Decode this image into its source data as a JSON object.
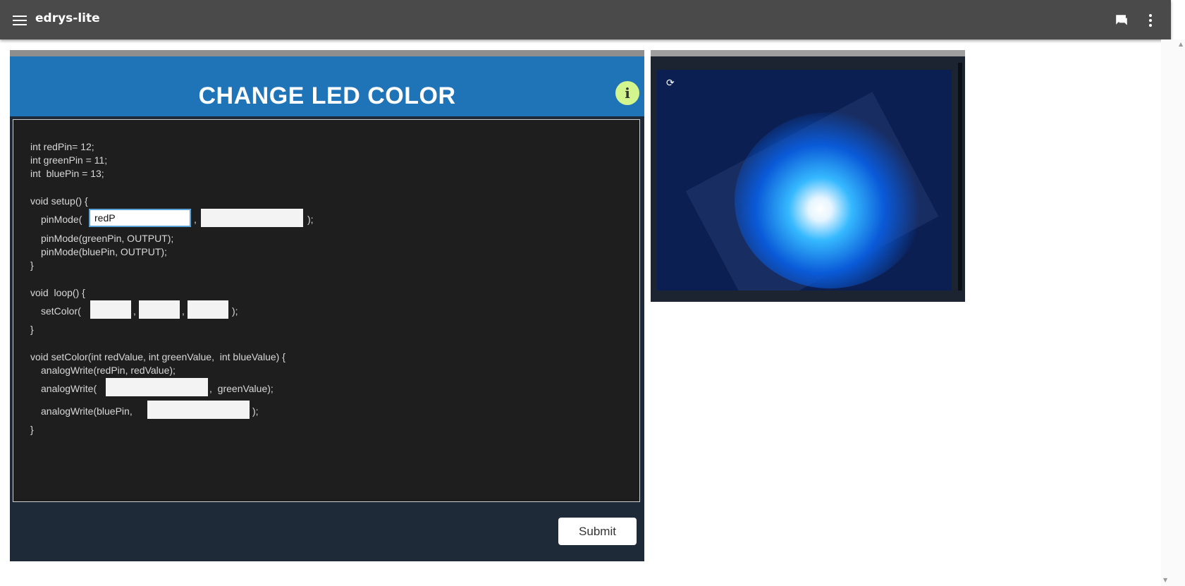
{
  "app": {
    "title": "edrys-lite"
  },
  "icons": {
    "menu": "menu-icon",
    "chat": "chat-icon",
    "more": "more-vertical-icon",
    "info": "info-icon",
    "refresh": "refresh-icon"
  },
  "panel": {
    "title": "CHANGE LED COLOR",
    "info_label": "i",
    "submit_label": "Submit"
  },
  "code": {
    "line1": "int redPin= 12;",
    "line2": "int greenPin = 11;",
    "line3": "int  bluePin = 13;",
    "line4": "void setup() {",
    "pinmode_open": "pinMode(",
    "comma": ",",
    "close_paren_semi": ");",
    "line_green": "pinMode(greenPin, OUTPUT);",
    "line_blue": "pinMode(bluePin, OUTPUT);",
    "close_brace": "}",
    "loop": "void  loop() {",
    "setcolor_open": "setColor(",
    "setcolor_def": "void setColor(int redValue, int greenValue,  int blueValue) {",
    "analog_red": "analogWrite(redPin, redValue);",
    "analog_open": "analogWrite(",
    "analog_green_tail": ",  greenValue);",
    "analog_blue_open": "analogWrite(bluePin,",
    "input_values": {
      "pinmode_pin": "redP",
      "pinmode_mode": "",
      "set_r": "",
      "set_g": "",
      "set_b": "",
      "analog_green_pin": "",
      "analog_blue_value": ""
    }
  },
  "colors": {
    "header_blue": "#1f73b7",
    "info_green": "#d2f58e",
    "topbar": "#4a4a4a"
  }
}
